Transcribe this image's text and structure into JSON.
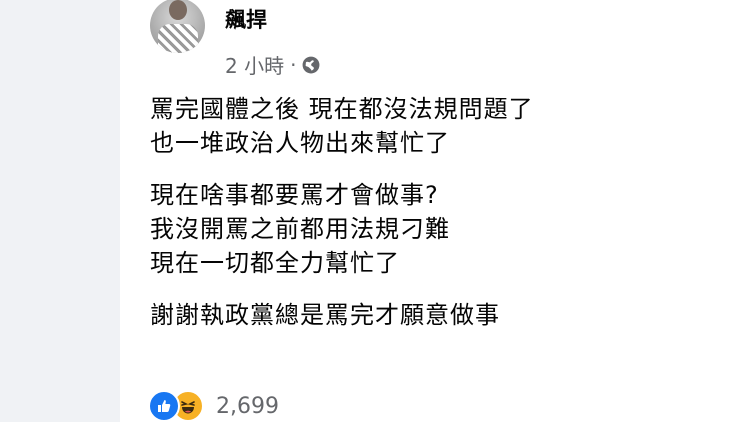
{
  "post": {
    "author": "飆捍",
    "timestamp": "2 小時",
    "separator": "·",
    "privacy_icon": "globe-icon",
    "paragraphs": [
      [
        "罵完國體之後 現在都沒法規問題了",
        "也一堆政治人物出來幫忙了"
      ],
      [
        "現在啥事都要罵才會做事?",
        "我沒開罵之前都用法規刁難",
        "現在一切都全力幫忙了"
      ],
      [
        "謝謝執政黨總是罵完才願意做事"
      ]
    ]
  },
  "reactions": {
    "icons": [
      "like-icon",
      "haha-icon"
    ],
    "count": "2,699"
  },
  "colors": {
    "page_bg": "#f0f2f5",
    "card_bg": "#ffffff",
    "text": "#050505",
    "secondary": "#65676b",
    "like": "#1877f2",
    "haha": "#f7b125"
  }
}
